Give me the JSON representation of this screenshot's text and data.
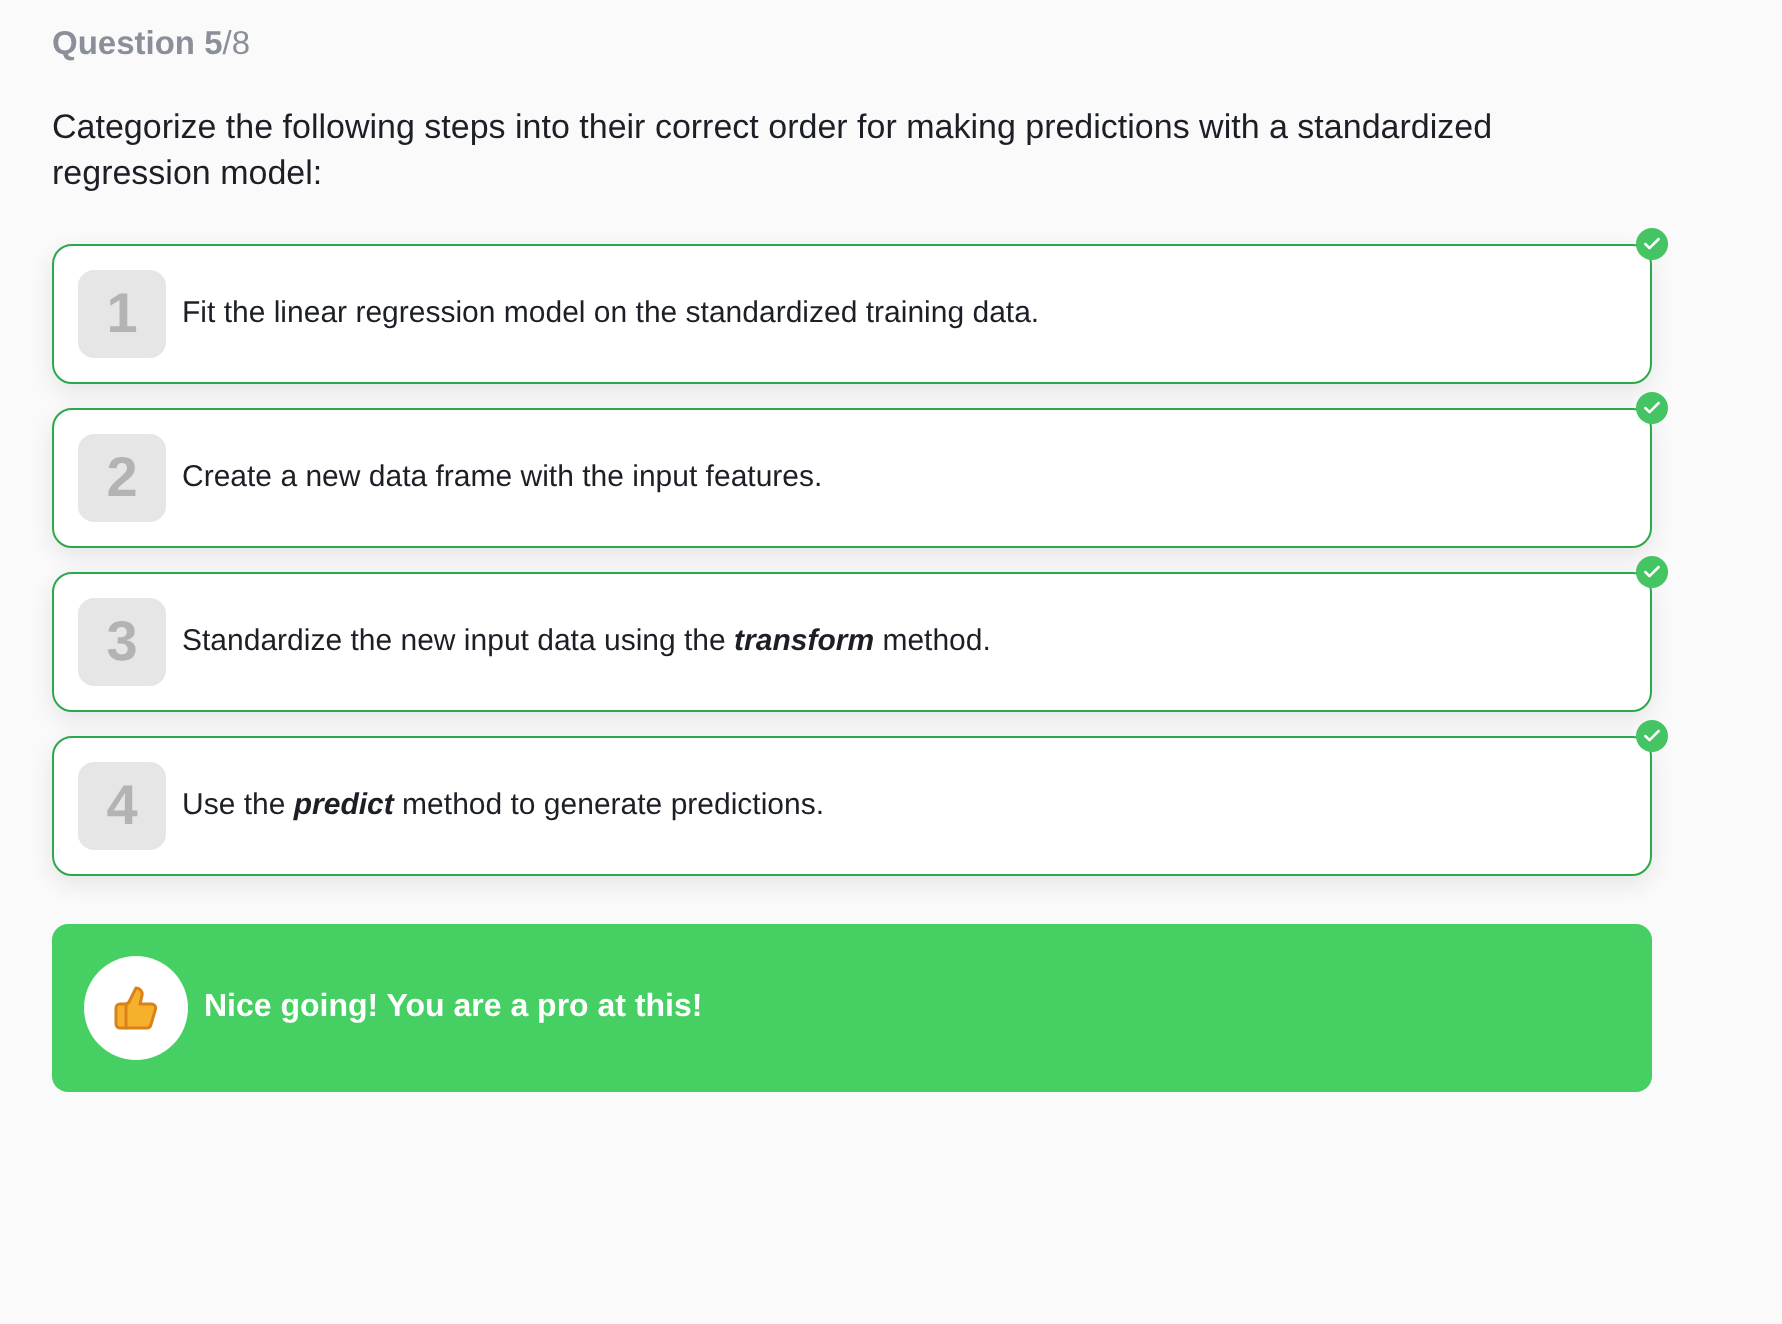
{
  "header": {
    "counter": "**Question 5**/8"
  },
  "prompt": "Categorize the following steps into their correct order for making predictions with a standardized regression model:",
  "steps": [
    {
      "number": "1",
      "text": "Fit the linear regression model on the standardized training data.",
      "correct": true
    },
    {
      "number": "2",
      "text": "Create a new data frame with the input features.",
      "correct": true
    },
    {
      "number": "3",
      "text": "Standardize the new input data using the **transform** method.",
      "correct": true
    },
    {
      "number": "4",
      "text": "Use the **predict** method to generate predictions.",
      "correct": true
    }
  ],
  "feedback": {
    "kind": "success",
    "message": "Nice going! You are a pro at this!"
  }
}
